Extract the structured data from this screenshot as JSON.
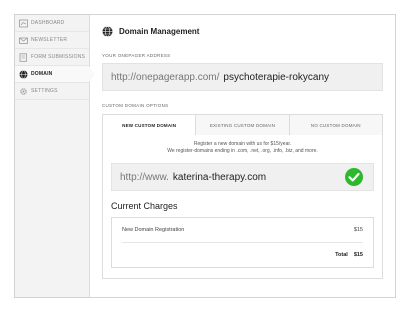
{
  "sidebar": {
    "items": [
      {
        "label": "DASHBOARD",
        "icon": "dashboard-icon"
      },
      {
        "label": "NEWSLETTER",
        "icon": "mail-icon"
      },
      {
        "label": "FORM SUBMISSIONS",
        "icon": "form-icon"
      },
      {
        "label": "DOMAIN",
        "icon": "globe-icon",
        "active": true
      },
      {
        "label": "SETTINGS",
        "icon": "gear-icon"
      }
    ]
  },
  "header": {
    "title": "Domain Management",
    "icon": "globe-icon"
  },
  "address": {
    "label": "YOUR ONEPAGER ADDRESS",
    "prefix": "http://onepagerapp.com/",
    "slug": "psychoterapie-rokycany"
  },
  "custom": {
    "label": "CUSTOM DOMAIN OPTIONS",
    "tabs": [
      "NEW CUSTOM DOMAIN",
      "EXISTING CUSTOM DOMAIN",
      "NO CUSTOM DOMAIN"
    ],
    "active_tab": 0,
    "info_line1": "Register a new domain with us for $15/year.",
    "info_line2": "We register-domains ending in .com, .net, .org, .info, .biz, and more.",
    "domain_prefix": "http://www.",
    "domain_value": "katerina-therapy.com",
    "status_icon": "check-circle-icon",
    "status_color": "#2eb82e"
  },
  "charges": {
    "title": "Current Charges",
    "items": [
      {
        "label": "New Domain Registration",
        "amount": "$15"
      }
    ],
    "total_label": "Total",
    "total_amount": "$15"
  }
}
